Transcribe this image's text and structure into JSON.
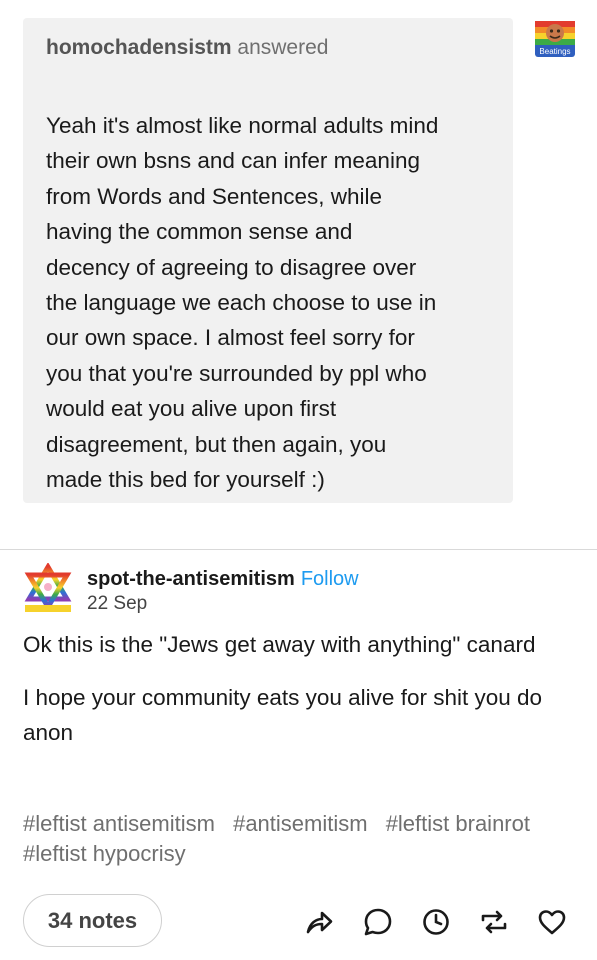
{
  "answer": {
    "asker": "homochadensistm",
    "verb": "answered",
    "asker_avatar_label": "Beatings",
    "lines": [
      "Yeah it's almost like normal adults mind",
      "their own bsns and can infer meaning",
      "from Words and Sentences, while",
      "having the common sense and",
      "decency of agreeing to disagree over",
      "the language we each choose to use in",
      "our own space. I almost feel sorry for",
      "you that you're surrounded by ppl who",
      "would eat you alive upon first",
      "disagreement, but then again, you",
      "made this bed for yourself :)"
    ]
  },
  "post": {
    "username": "spot-the-antisemitism",
    "follow_label": "Follow",
    "date": "22 Sep",
    "paragraphs": [
      "Ok this  is the \"Jews get away with anything\" canard",
      "I hope your community eats you alive for shit you do anon"
    ],
    "tags": [
      "#leftist antisemitism",
      "#antisemitism",
      "#leftist brainrot",
      "#leftist hypocrisy"
    ]
  },
  "footer": {
    "notes_label": "34 notes",
    "icons": [
      "share-icon",
      "reply-icon",
      "schedule-icon",
      "reblog-icon",
      "like-icon"
    ]
  },
  "colors": {
    "card_bg": "#f1f1f1",
    "follow": "#1d9bf0",
    "muted": "#6f6f6f"
  }
}
